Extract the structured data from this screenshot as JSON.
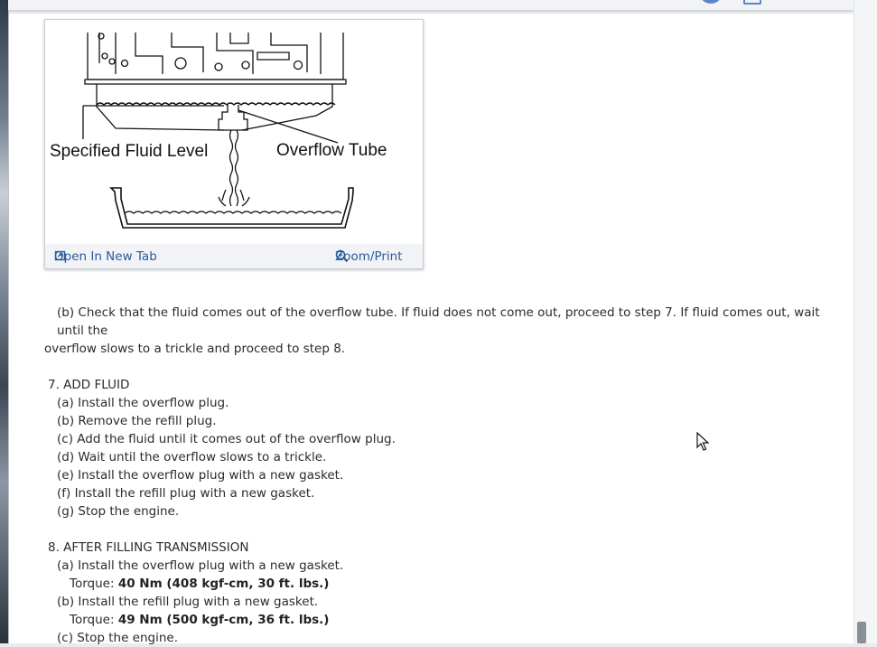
{
  "figure": {
    "label_left": "Specified Fluid Level",
    "label_right": "Overflow Tube",
    "open_tab": "Open In New Tab",
    "zoom_print": "Zoom/Print"
  },
  "step6b": {
    "line1": "(b) Check that the fluid comes out of the overflow tube. If fluid does not come out, proceed to step 7. If fluid comes out, wait until the",
    "line2": "overflow slows to a trickle and proceed to step 8."
  },
  "step7": {
    "title": "7. ADD FLUID",
    "items": [
      "(a) Install the overflow plug.",
      "(b) Remove the refill plug.",
      "(c) Add the fluid until it comes out of the overflow plug.",
      "(d) Wait until the overflow slows to a trickle.",
      "(e) Install the overflow plug with a new gasket.",
      "(f) Install the refill plug with a new gasket.",
      "(g) Stop the engine."
    ]
  },
  "step8": {
    "title": "8. AFTER FILLING TRANSMISSION",
    "a": "(a) Install the overflow plug with a new gasket.",
    "torque_label": "Torque:",
    "torque_a": "40 Nm (408 kgf-cm, 30 ft. lbs.)",
    "b": "(b) Install the refill plug with a new gasket.",
    "torque_b": "49 Nm (500 kgf-cm, 36 ft. lbs.)",
    "c": "(c) Stop the engine."
  },
  "icons": {
    "open_tab": "open-new-tab-icon",
    "zoom": "magnifier-zoom-icon",
    "cursor": "mouse-pointer-icon"
  }
}
